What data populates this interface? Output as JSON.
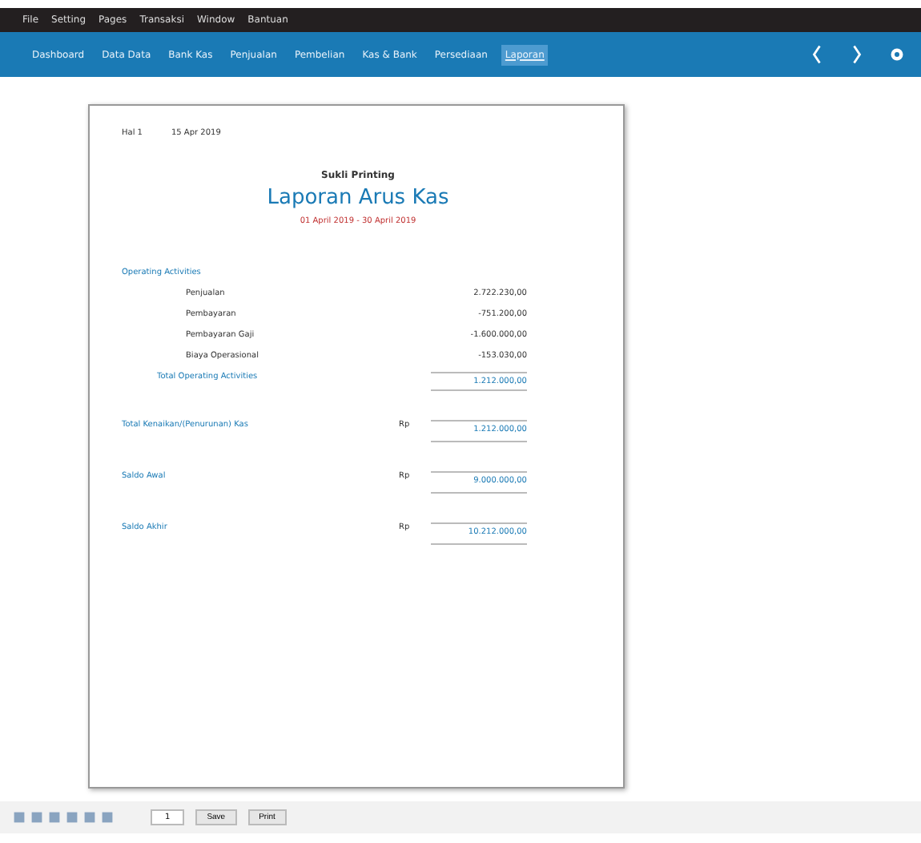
{
  "menu": [
    "File",
    "Setting",
    "Pages",
    "Transaksi",
    "Window",
    "Bantuan"
  ],
  "nav": [
    {
      "label": "Dashboard",
      "selected": false
    },
    {
      "label": "Data Data",
      "selected": false
    },
    {
      "label": "Bank Kas",
      "selected": false
    },
    {
      "label": "Penjualan",
      "selected": false
    },
    {
      "label": "Pembelian",
      "selected": false
    },
    {
      "label": "Kas & Bank",
      "selected": false
    },
    {
      "label": "Persediaan",
      "selected": false
    },
    {
      "label": "Laporan",
      "selected": true
    }
  ],
  "report": {
    "page": "Hal 1",
    "date": "15 Apr 2019",
    "company": "Sukli Printing",
    "title": "Laporan Arus Kas",
    "period": "01 April 2019 - 30 April 2019",
    "section": "Operating Activities",
    "items": [
      {
        "label": "Penjualan",
        "amount": "2.722.230,00"
      },
      {
        "label": "Pembayaran",
        "amount": "-751.200,00"
      },
      {
        "label": "Pembayaran Gaji",
        "amount": "-1.600.000,00"
      },
      {
        "label": "Biaya Operasional",
        "amount": "-153.030,00"
      }
    ],
    "section_total": {
      "label": "Total Operating Activities",
      "amount": "1.212.000,00"
    },
    "summary": [
      {
        "label": "Total Kenaikan/(Penurunan) Kas",
        "currency": "Rp",
        "amount": "1.212.000,00"
      },
      {
        "label": "Saldo Awal",
        "currency": "Rp",
        "amount": "9.000.000,00"
      },
      {
        "label": "Saldo Akhir",
        "currency": "Rp",
        "amount": "10.212.000,00"
      }
    ]
  },
  "toolbar": {
    "page_box": "1",
    "buttons": [
      "Save",
      "Print"
    ]
  }
}
